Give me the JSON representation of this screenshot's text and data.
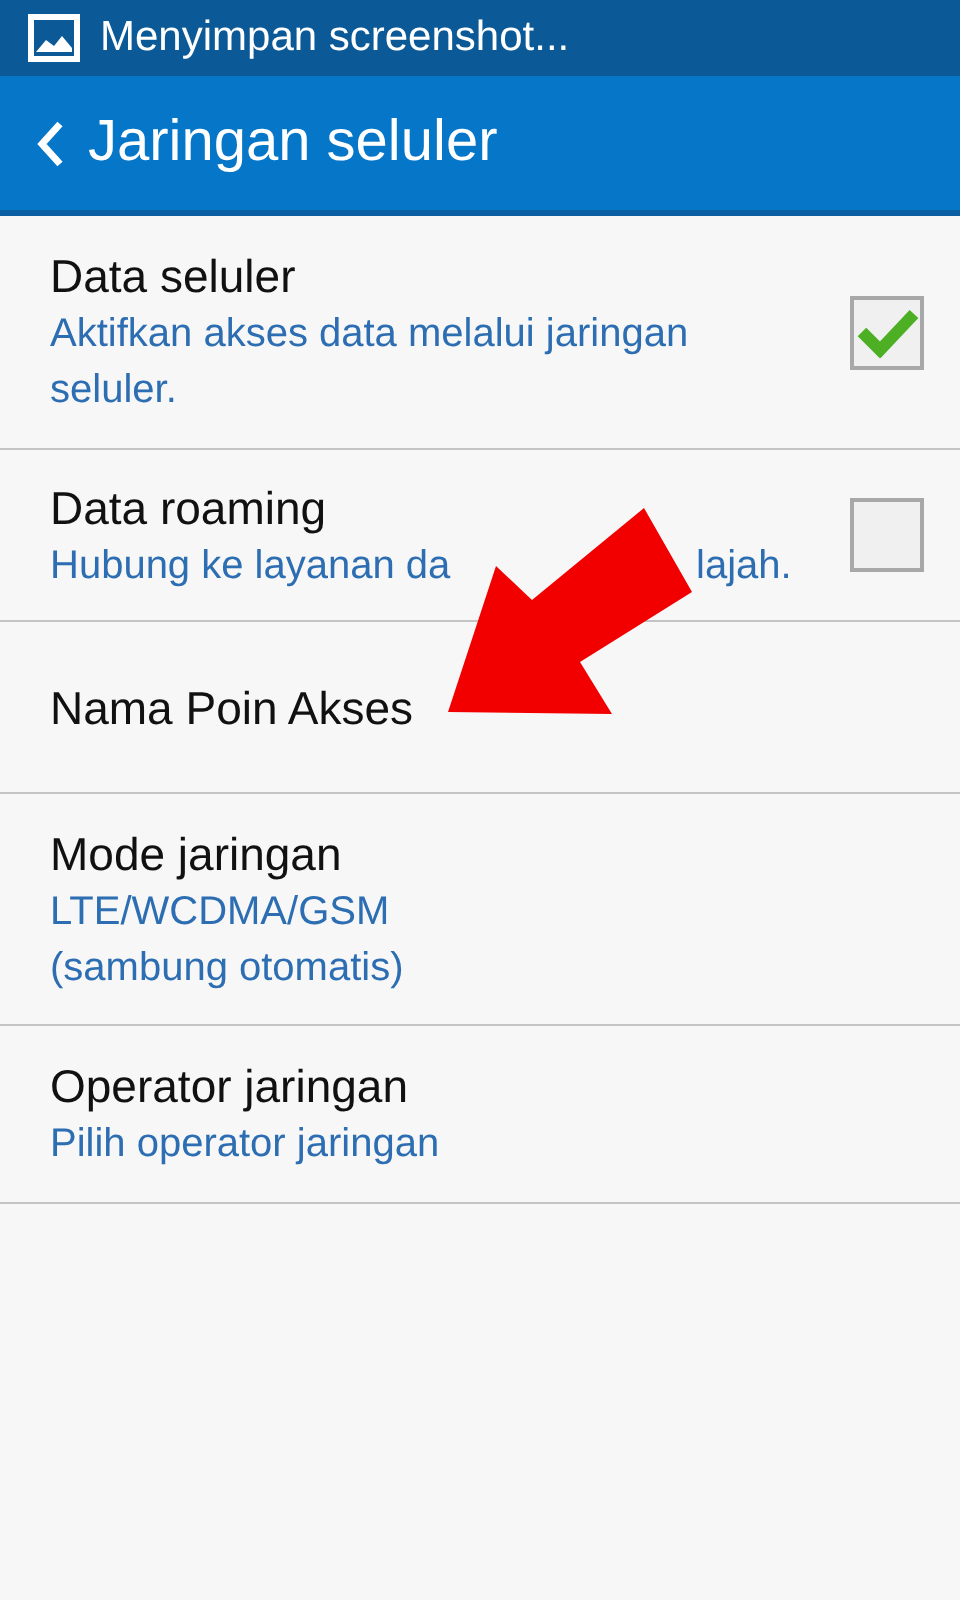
{
  "status_bar": {
    "notification": "Menyimpan screenshot..."
  },
  "action_bar": {
    "title": "Jaringan seluler"
  },
  "settings": [
    {
      "kind": "checkbox",
      "title": "Data seluler",
      "summary": [
        "Aktifkan akses data melalui jaringan seluler."
      ],
      "checked": true
    },
    {
      "kind": "checkbox",
      "title": "Data roaming",
      "summary": [
        "Hubung ke layanan da",
        "lajah."
      ],
      "checked": false
    },
    {
      "kind": "plain",
      "title": "Nama Poin Akses"
    },
    {
      "kind": "plain",
      "title": "Mode jaringan",
      "summary": [
        "LTE/WCDMA/GSM",
        "(sambung otomatis)"
      ]
    },
    {
      "kind": "plain",
      "title": "Operator jaringan",
      "summary": [
        "Pilih operator jaringan"
      ]
    }
  ]
}
